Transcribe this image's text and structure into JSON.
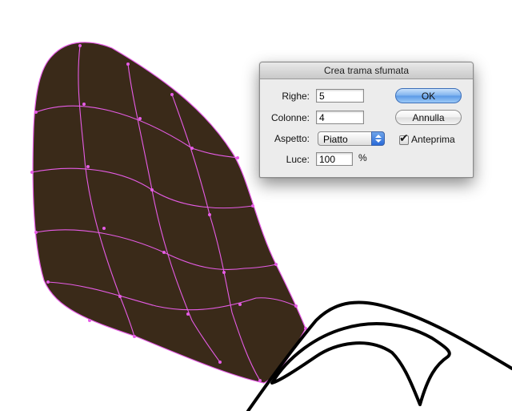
{
  "dialog": {
    "title": "Crea trama sfumata",
    "rows_label": "Righe:",
    "rows_value": "5",
    "columns_label": "Colonne:",
    "columns_value": "4",
    "appearance_label": "Aspetto:",
    "appearance_value": "Piatto",
    "highlight_label": "Luce:",
    "highlight_value": "100",
    "percent_sign": "%",
    "ok_label": "OK",
    "cancel_label": "Annulla",
    "preview_label": "Anteprima",
    "preview_checked": true,
    "checkmark": "✔"
  },
  "artwork": {
    "fill_color": "#3a2a19",
    "mesh_color": "#e65ce6",
    "stroke_color": "#000000",
    "icons": [
      "mesh-shape",
      "mesh-anchor-point",
      "wing-outline"
    ]
  }
}
